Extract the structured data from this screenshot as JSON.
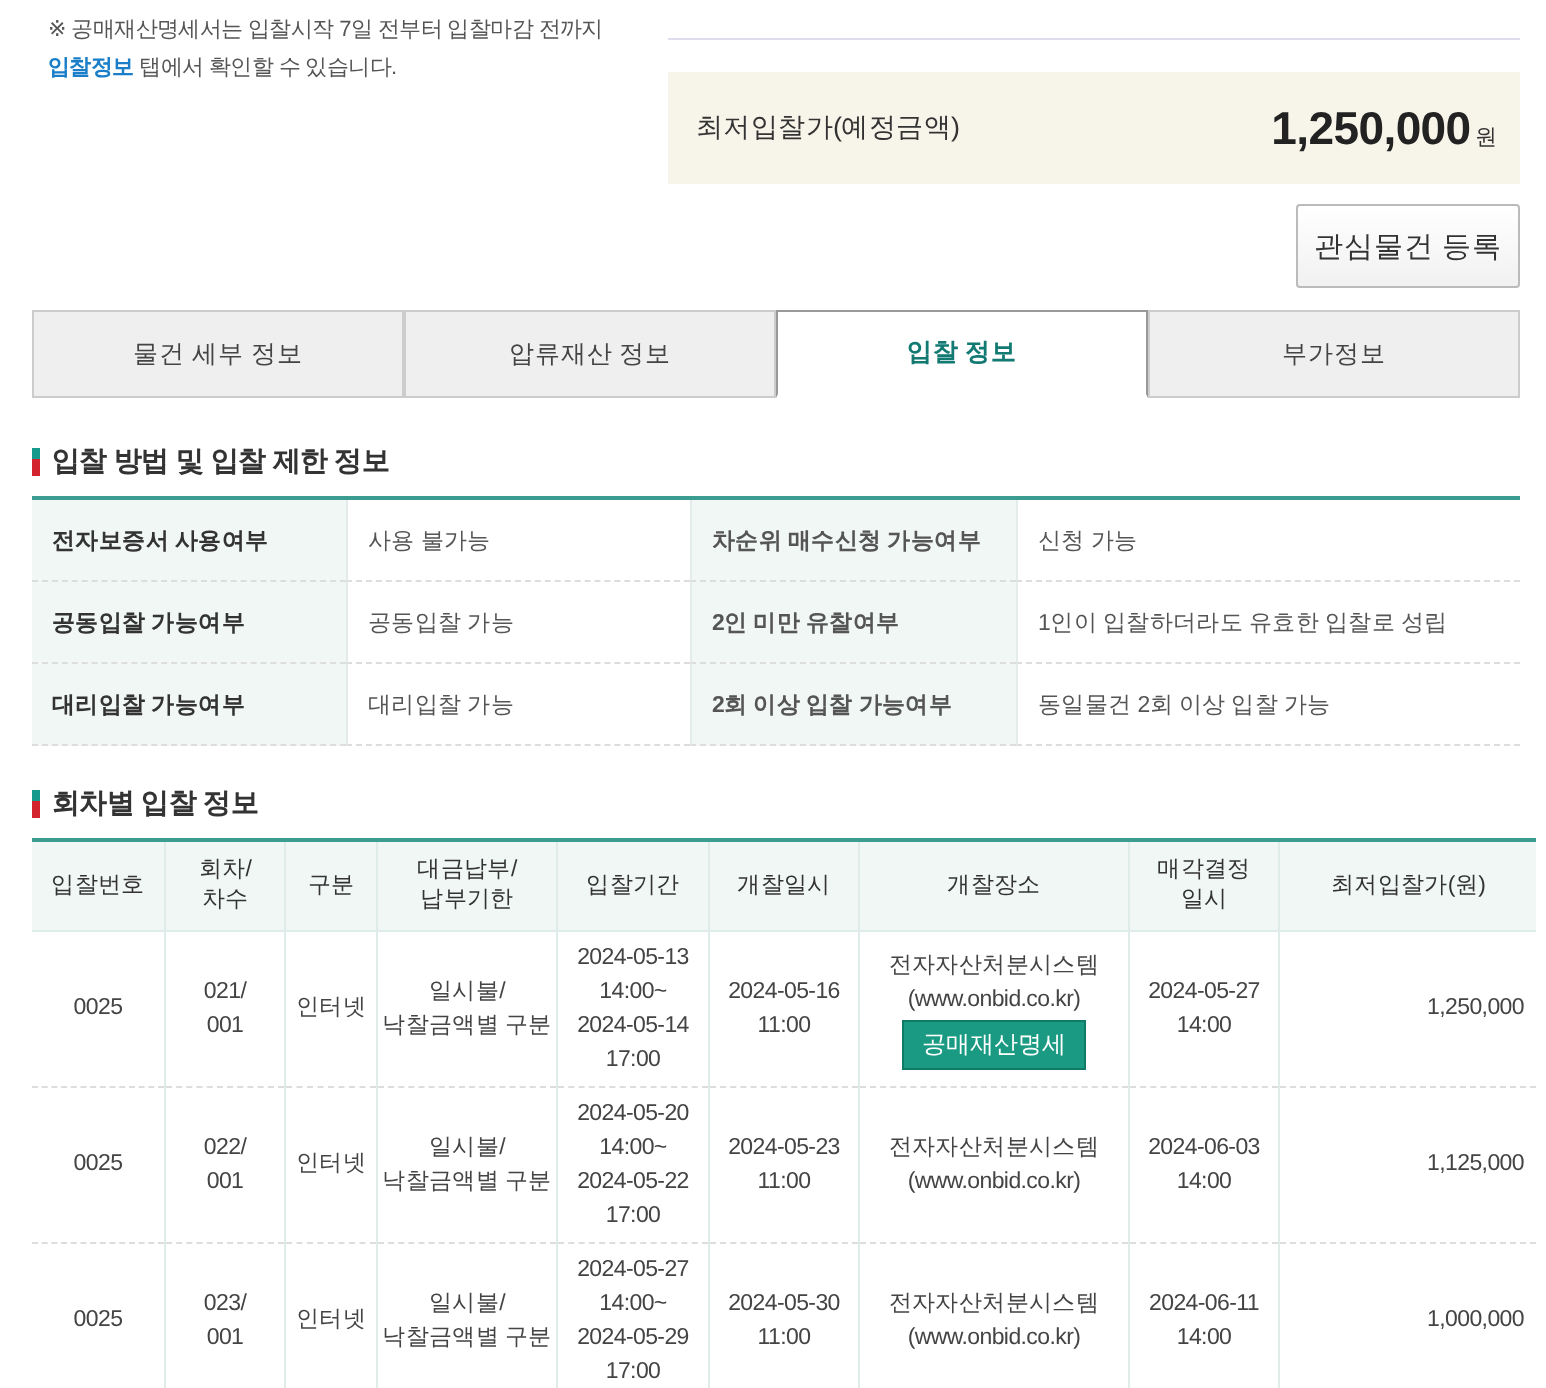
{
  "notice": "※ 공매재산명세서는 입찰시작 7일 전부터 입찰마감 전까지 **입찰정보** 탭에서 확인할 수 있습니다.",
  "price": {
    "label": "최저입찰가(예정금액)",
    "amount": "1,250,000",
    "unit": "원"
  },
  "watch_button": "관심물건 등록",
  "tabs": [
    {
      "label": "물건 세부 정보",
      "selected": false
    },
    {
      "label": "압류재산 정보",
      "selected": false
    },
    {
      "label": "입찰 정보",
      "selected": true
    },
    {
      "label": "부가정보",
      "selected": false
    }
  ],
  "method_section": {
    "title": "입찰 방법 및 입찰 제한 정보",
    "rows": [
      {
        "label_1": "전자보증서 사용여부",
        "value_1": "사용 불가능",
        "label_2": "차순위 매수신청 가능여부",
        "value_2": "신청 가능"
      },
      {
        "label_1": "공동입찰 가능여부",
        "value_1": "공동입찰 가능",
        "label_2": "2인 미만 유찰여부",
        "value_2": "1인이 입찰하더라도 유효한 입찰로 성립"
      },
      {
        "label_1": "대리입찰 가능여부",
        "value_1": "대리입찰 가능",
        "label_2": "2회 이상 입찰 가능여부",
        "value_2": "동일물건 2회 이상 입찰 가능"
      }
    ]
  },
  "round_section": {
    "title": "회차별 입찰 정보",
    "columns": [
      "입찰번호",
      "회차/\n차수",
      "구분",
      "대금납부/\n납부기한",
      "입찰기간",
      "개찰일시",
      "개찰장소",
      "매각결정\n일시",
      "최저입찰가(원)"
    ],
    "rows": [
      {
        "number": "0025",
        "round": "021/\n001",
        "type": "인터넷",
        "payment": "일시불/\n낙찰금액별 구분",
        "period": "2024-05-13\n14:00~\n2024-05-14\n17:00",
        "opening": "2024-05-16\n11:00",
        "place": "전자자산처분시스템\n(www.onbid.co.kr)",
        "place_button": "공매재산명세",
        "decision": "2024-05-27\n14:00",
        "min_price": "1,250,000"
      },
      {
        "number": "0025",
        "round": "022/\n001",
        "type": "인터넷",
        "payment": "일시불/\n낙찰금액별 구분",
        "period": "2024-05-20\n14:00~\n2024-05-22\n17:00",
        "opening": "2024-05-23\n11:00",
        "place": "전자자산처분시스템\n(www.onbid.co.kr)",
        "decision": "2024-06-03\n14:00",
        "min_price": "1,125,000"
      },
      {
        "number": "0025",
        "round": "023/\n001",
        "type": "인터넷",
        "payment": "일시불/\n낙찰금액별 구분",
        "period": "2024-05-27\n14:00~\n2024-05-29\n17:00",
        "opening": "2024-05-30\n11:00",
        "place": "전자자산처분시스템\n(www.onbid.co.kr)",
        "decision": "2024-06-11\n14:00",
        "min_price": "1,000,000"
      }
    ]
  }
}
